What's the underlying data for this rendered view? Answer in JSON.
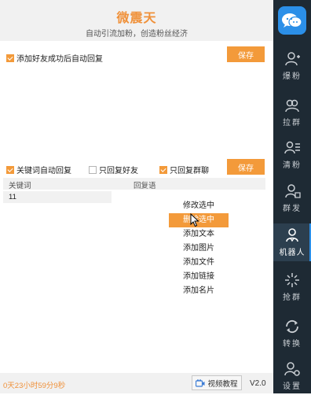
{
  "header": {
    "title": "微震天",
    "subtitle": "自动引流加粉，创造粉丝经济"
  },
  "auto_reply_friend": {
    "checked": true,
    "label": "添加好友成功后自动回复",
    "save_label": "保存"
  },
  "keyword_section": {
    "opt_keyword": {
      "checked": true,
      "label": "关键词自动回复"
    },
    "opt_friend_only": {
      "checked": false,
      "label": "只回复好友"
    },
    "opt_group_only": {
      "checked": true,
      "label": "只回复群聊"
    },
    "save_label": "保存",
    "columns": [
      "关键词",
      "回复语"
    ],
    "rows": [
      {
        "keyword": "11",
        "reply": ""
      }
    ]
  },
  "context_menu": {
    "items": [
      "修改选中",
      "删除选中",
      "添加文本",
      "添加图片",
      "添加文件",
      "添加链接",
      "添加名片"
    ],
    "selected_index": 1
  },
  "footer": {
    "timer": "0天23小时59分9秒",
    "video_label": "视频教程",
    "version": "V2.0"
  },
  "sidebar": {
    "items": [
      {
        "label": "爆粉",
        "icon": "add-user-icon"
      },
      {
        "label": "拉群",
        "icon": "group-icon"
      },
      {
        "label": "清粉",
        "icon": "user-list-icon"
      },
      {
        "label": "群发",
        "icon": "broadcast-icon"
      },
      {
        "label": "机器人",
        "icon": "robot-user-icon",
        "active": true
      },
      {
        "label": "抢群",
        "icon": "spark-icon"
      },
      {
        "label": "转换",
        "icon": "refresh-icon"
      },
      {
        "label": "设置",
        "icon": "user-settings-icon"
      }
    ],
    "accent": "#2b8fe8"
  },
  "colors": {
    "accent": "#f39a3a",
    "title": "#f0913a",
    "sidebar_bg": "#1e2a34"
  }
}
